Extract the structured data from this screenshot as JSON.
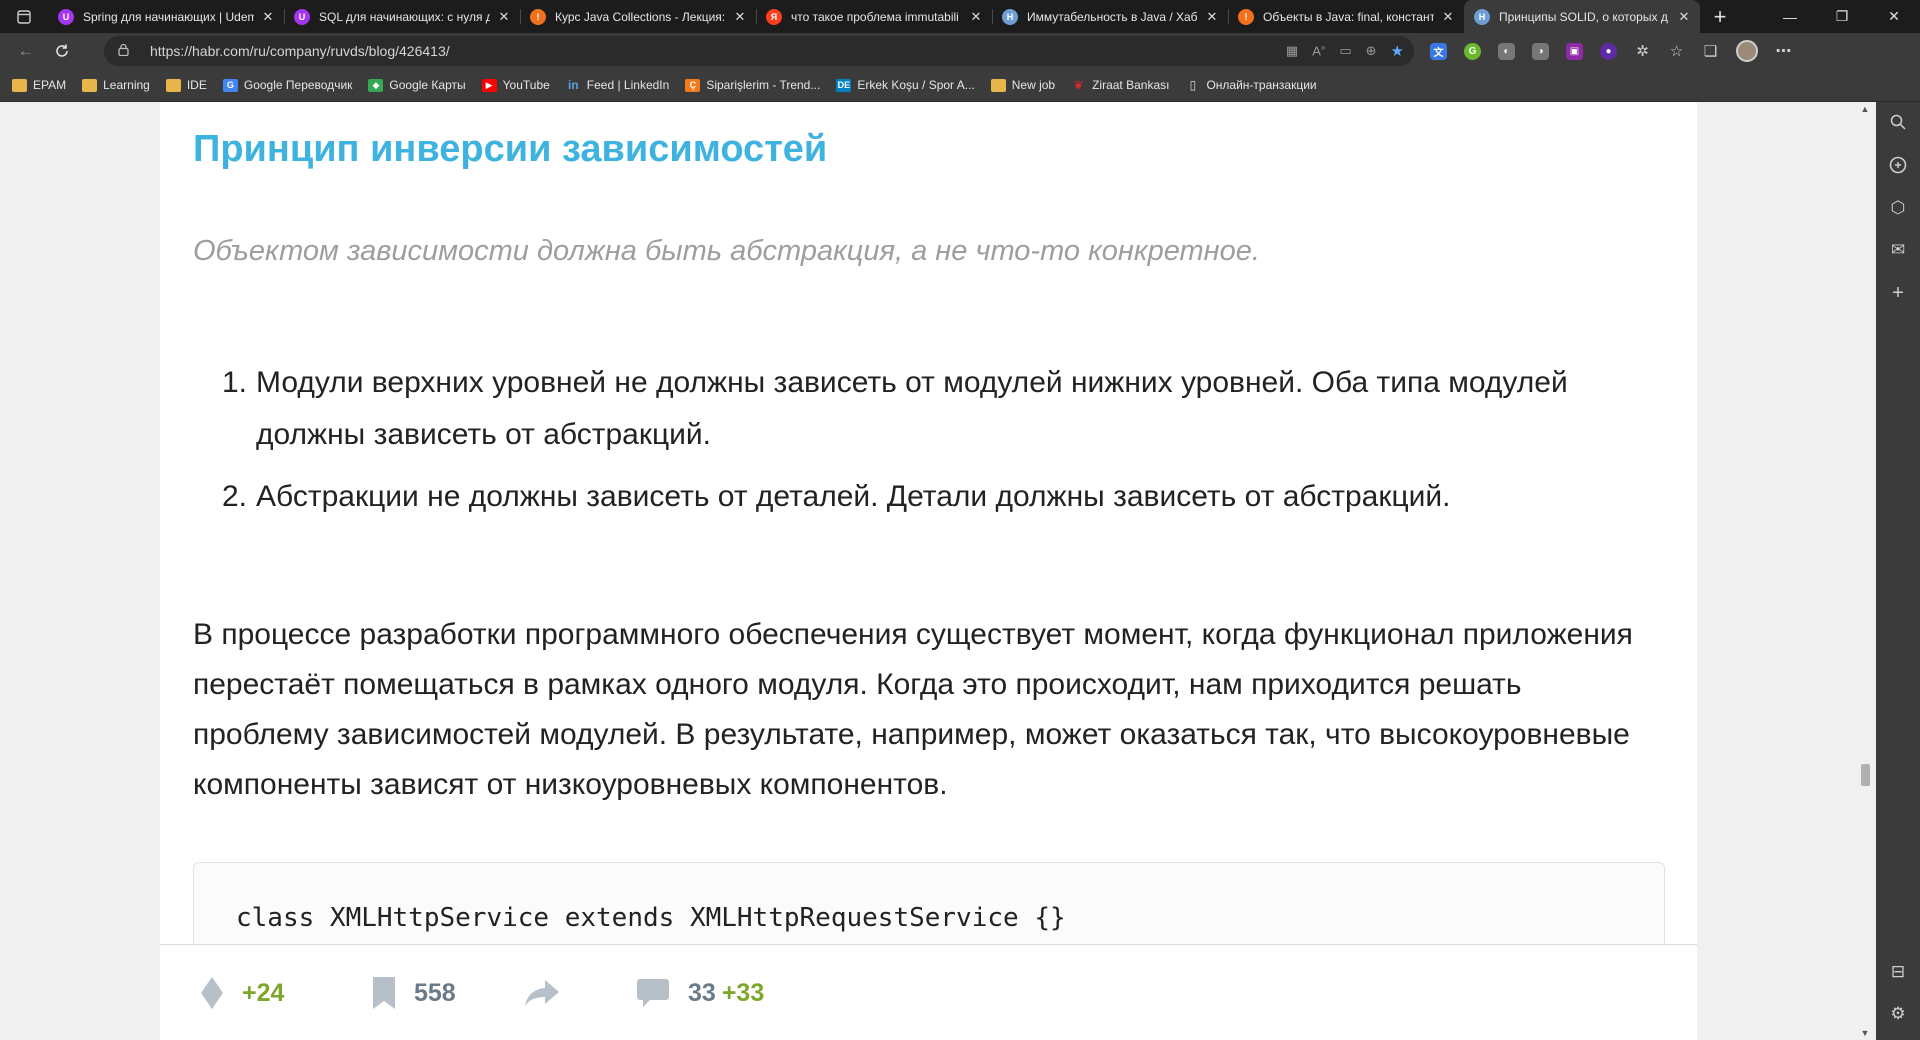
{
  "browser": {
    "tabs": [
      {
        "title": "Spring для начинающих | Udem",
        "favicon": "udemy-icon",
        "color": "#a435f0",
        "glyph": "U",
        "active": false
      },
      {
        "title": "SQL для начинающих: с нуля д",
        "favicon": "udemy-icon",
        "color": "#a435f0",
        "glyph": "U",
        "active": false
      },
      {
        "title": "Курс Java Collections - Лекция:",
        "favicon": "javarush-icon",
        "color": "#f2711c",
        "glyph": "!",
        "active": false
      },
      {
        "title": "что такое проблема immutabili",
        "favicon": "yandex-icon",
        "color": "#fc3f1d",
        "glyph": "Я",
        "active": false
      },
      {
        "title": "Иммутабельность в Java / Хабр",
        "favicon": "habr-icon",
        "color": "#6f9ed2",
        "glyph": "H",
        "active": false
      },
      {
        "title": "Объекты в Java: final, констант",
        "favicon": "javarush-icon",
        "color": "#f2711c",
        "glyph": "!",
        "active": false
      },
      {
        "title": "Принципы SOLID, о которых д",
        "favicon": "habr-icon",
        "color": "#6f9ed2",
        "glyph": "H",
        "active": true
      }
    ],
    "close_glyph": "✕",
    "new_tab_glyph": "+",
    "url": "https://habr.com/ru/company/ruvds/blog/426413/",
    "bookmarks": [
      {
        "label": "EPAM",
        "icon": "folder-icon"
      },
      {
        "label": "Learning",
        "icon": "folder-icon"
      },
      {
        "label": "IDE",
        "icon": "folder-icon"
      },
      {
        "label": "Google Переводчик",
        "icon": "google-translate-icon"
      },
      {
        "label": "Google Карты",
        "icon": "google-maps-icon"
      },
      {
        "label": "YouTube",
        "icon": "youtube-icon"
      },
      {
        "label": "Feed | LinkedIn",
        "icon": "linkedin-icon"
      },
      {
        "label": "Siparişlerim - Trend...",
        "icon": "trendyol-icon"
      },
      {
        "label": "Erkek Koşu / Spor A...",
        "icon": "decathlon-icon"
      },
      {
        "label": "New job",
        "icon": "folder-icon"
      },
      {
        "label": "Ziraat Bankası",
        "icon": "ziraat-icon"
      },
      {
        "label": "Онлайн-транзакции",
        "icon": "page-icon"
      }
    ]
  },
  "article": {
    "heading": "Принцип инверсии зависимостей",
    "epigraph": "Объектом зависимости должна быть абстракция, а не что-то конкретное.",
    "principles": [
      {
        "num": "1.",
        "text": "Модули верхних уровней не должны зависеть от модулей нижних уровней. Оба типа модулей должны зависеть от абстракций."
      },
      {
        "num": "2.",
        "text": "Абстракции не должны зависеть от деталей. Детали должны зависеть от абстракций."
      }
    ],
    "paragraph": "В процессе разработки программного обеспечения существует момент, когда функционал приложения перестаёт помещаться в рамках одного модуля. Когда это происходит, нам приходится решать проблему зависимостей модулей. В результате, например, может оказаться так, что высокоуровневые компоненты зависят от низкоуровневых компонентов.",
    "code": "class XMLHttpService extends XMLHttpRequestService {}"
  },
  "stats": {
    "rating": "+24",
    "bookmarks": "558",
    "comments": "33",
    "comments_new": "+33"
  },
  "colors": {
    "heading": "#3fb3e0",
    "green": "#7ca72a",
    "icon_gray": "#b7c0c8"
  }
}
